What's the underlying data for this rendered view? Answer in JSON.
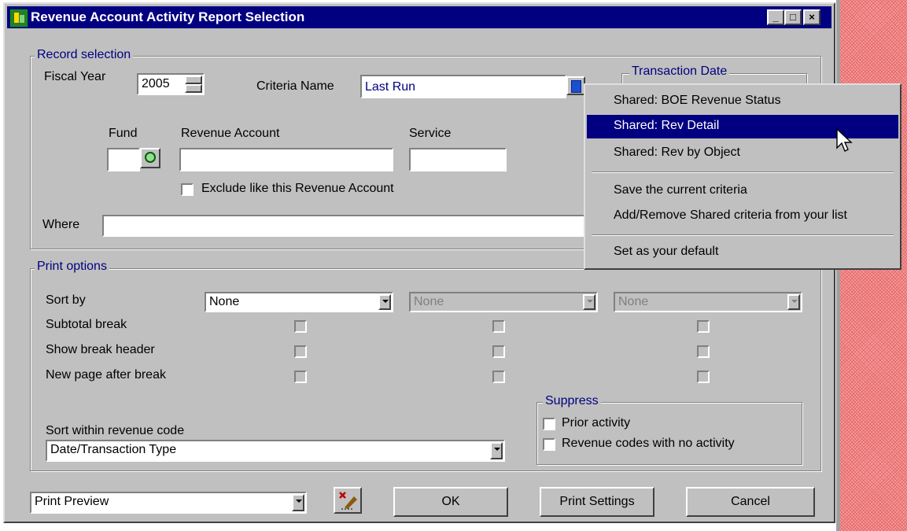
{
  "window": {
    "title": "Revenue Account Activity Report Selection",
    "controls": {
      "minimize": "_",
      "maximize": "□",
      "close": "×"
    }
  },
  "record_selection": {
    "group_label": "Record selection",
    "fiscal_year_label": "Fiscal Year",
    "fiscal_year_value": "2005",
    "criteria_name_label": "Criteria Name",
    "criteria_name_value": "Last Run",
    "transaction_date_label": "Transaction Date",
    "fund_label": "Fund",
    "fund_value": "",
    "revenue_account_label": "Revenue Account",
    "revenue_account_value": "",
    "service_label": "Service",
    "service_value": "",
    "exclude_label": "Exclude like this Revenue Account",
    "exclude_checked": false,
    "where_label": "Where",
    "where_value": ""
  },
  "print_options": {
    "group_label": "Print options",
    "sort_by_label": "Sort by",
    "sort_by_values": [
      "None",
      "None",
      "None"
    ],
    "subtotal_break_label": "Subtotal break",
    "show_break_header_label": "Show break header",
    "new_page_after_break_label": "New page after break",
    "sort_within_label": "Sort within revenue code",
    "sort_within_value": "Date/Transaction Type",
    "suppress": {
      "group_label": "Suppress",
      "prior_activity_label": "Prior activity",
      "no_activity_label": "Revenue codes with no activity"
    }
  },
  "footer": {
    "output_value": "Print Preview",
    "ok_label": "OK",
    "print_settings_label": "Print Settings",
    "cancel_label": "Cancel"
  },
  "criteria_menu": {
    "items": [
      {
        "label": "Shared: BOE Revenue Status",
        "selected": false
      },
      {
        "label": "Shared: Rev Detail",
        "selected": true
      },
      {
        "label": "Shared: Rev by Object",
        "selected": false
      },
      {
        "label": "Save the current criteria",
        "selected": false
      },
      {
        "label": "Add/Remove Shared criteria from your list",
        "selected": false
      },
      {
        "label": "Set as your default",
        "selected": false
      }
    ]
  },
  "colors": {
    "title_bar": "#000080",
    "dialog_face": "#c0c0c0",
    "group_label_text": "#000080",
    "menu_highlight": "#000080"
  }
}
